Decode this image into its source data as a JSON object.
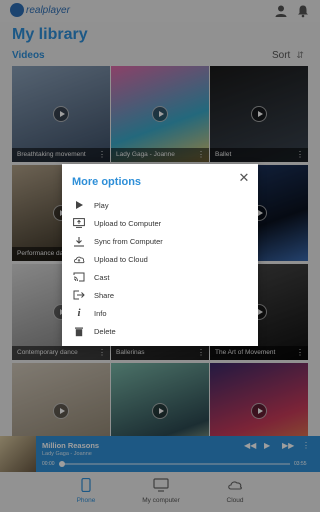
{
  "header": {
    "logo_text": "realplayer",
    "user_icon": "user-icon",
    "bell_icon": "notification-icon"
  },
  "page": {
    "title": "My library"
  },
  "section": {
    "title": "Videos",
    "sort_label": "Sort"
  },
  "grid": {
    "tiles": [
      {
        "caption": "Breathtaking movement"
      },
      {
        "caption": "Lady Gaga - Joanne"
      },
      {
        "caption": "Ballet"
      },
      {
        "caption": ""
      },
      {
        "caption": ""
      },
      {
        "caption": ""
      },
      {
        "caption": "Performance dance"
      },
      {
        "caption": ""
      },
      {
        "caption": ""
      },
      {
        "caption": "Contemporary dance"
      },
      {
        "caption": "Ballerinas"
      },
      {
        "caption": "The Art of Movement"
      },
      {
        "caption": ""
      },
      {
        "caption": ""
      },
      {
        "caption": ""
      }
    ]
  },
  "dialog": {
    "title": "More options",
    "items": [
      {
        "label": "Play",
        "icon": "play-icon"
      },
      {
        "label": "Upload to Computer",
        "icon": "computer-upload-icon"
      },
      {
        "label": "Sync from Computer",
        "icon": "download-icon"
      },
      {
        "label": "Upload to Cloud",
        "icon": "cloud-upload-icon"
      },
      {
        "label": "Cast",
        "icon": "cast-icon"
      },
      {
        "label": "Share",
        "icon": "share-icon"
      },
      {
        "label": "Info",
        "icon": "info-icon"
      },
      {
        "label": "Delete",
        "icon": "trash-icon"
      }
    ]
  },
  "player": {
    "title": "Million Reasons",
    "artist": "Lady Gaga - Joanne",
    "time_start": "00:00",
    "time_end": "03:55",
    "progress": 0
  },
  "nav": {
    "items": [
      {
        "label": "Phone",
        "active": true
      },
      {
        "label": "My computer",
        "active": false
      },
      {
        "label": "Cloud",
        "active": false
      }
    ]
  },
  "colors": {
    "accent": "#2e8fd8",
    "player_bg": "#2f8fd6"
  }
}
